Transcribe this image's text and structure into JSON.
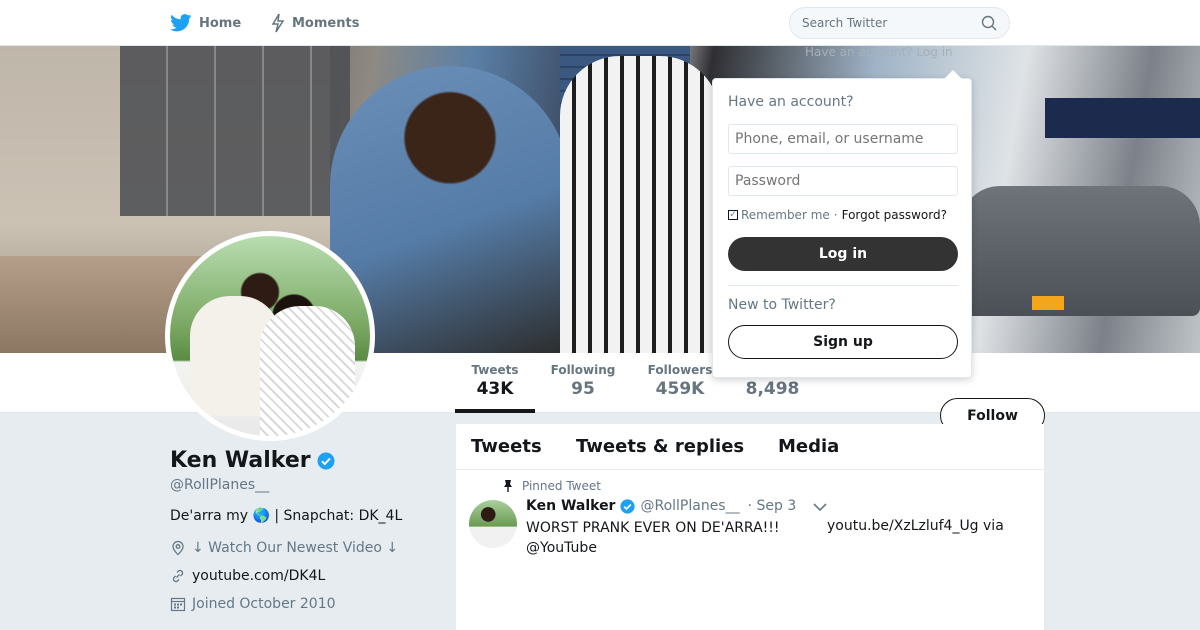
{
  "nav": {
    "home_label": "Home",
    "moments_label": "Moments",
    "search_placeholder": "Search Twitter",
    "have_account_hint": "Have an account? Log in"
  },
  "colors": {
    "brand_blue": "#1da1f2",
    "text_primary": "#14171a",
    "text_secondary": "#657786",
    "background": "#e6ecf0"
  },
  "profile": {
    "name": "Ken Walker",
    "handle": "@RollPlanes__",
    "bio": "De'arra my 🌎 | Snapchat: DK_4L",
    "location": "↓ Watch Our Newest Video ↓",
    "url": "youtube.com/DK4L",
    "joined": "Joined October 2010",
    "verified": true
  },
  "stats": [
    {
      "label": "Tweets",
      "value": "43K"
    },
    {
      "label": "Following",
      "value": "95"
    },
    {
      "label": "Followers",
      "value": "459K"
    },
    {
      "label": "",
      "value": "8,498"
    }
  ],
  "follow_label": "Follow",
  "timeline": {
    "tabs": [
      "Tweets",
      "Tweets & replies",
      "Media"
    ],
    "pinned_label": "Pinned Tweet",
    "tweet": {
      "name": "Ken Walker",
      "handle": "@RollPlanes__",
      "date": "· Sep 3",
      "text": "WORST PRANK EVER ON DE'ARRA!!! @YouTube",
      "link": "youtu.be/XzLzluf4_Ug via"
    }
  },
  "login": {
    "title": "Have an account?",
    "username_placeholder": "Phone, email, or username",
    "password_placeholder": "Password",
    "remember_label": "Remember me",
    "separator": "·",
    "forgot_label": "Forgot password?",
    "login_label": "Log in",
    "new_label": "New to Twitter?",
    "signup_label": "Sign up"
  },
  "icons": [
    "twitter-bird-icon",
    "moments-bolt-icon",
    "search-icon",
    "verified-badge-icon",
    "location-icon",
    "link-icon",
    "calendar-icon",
    "pin-icon",
    "chevron-down-icon"
  ]
}
